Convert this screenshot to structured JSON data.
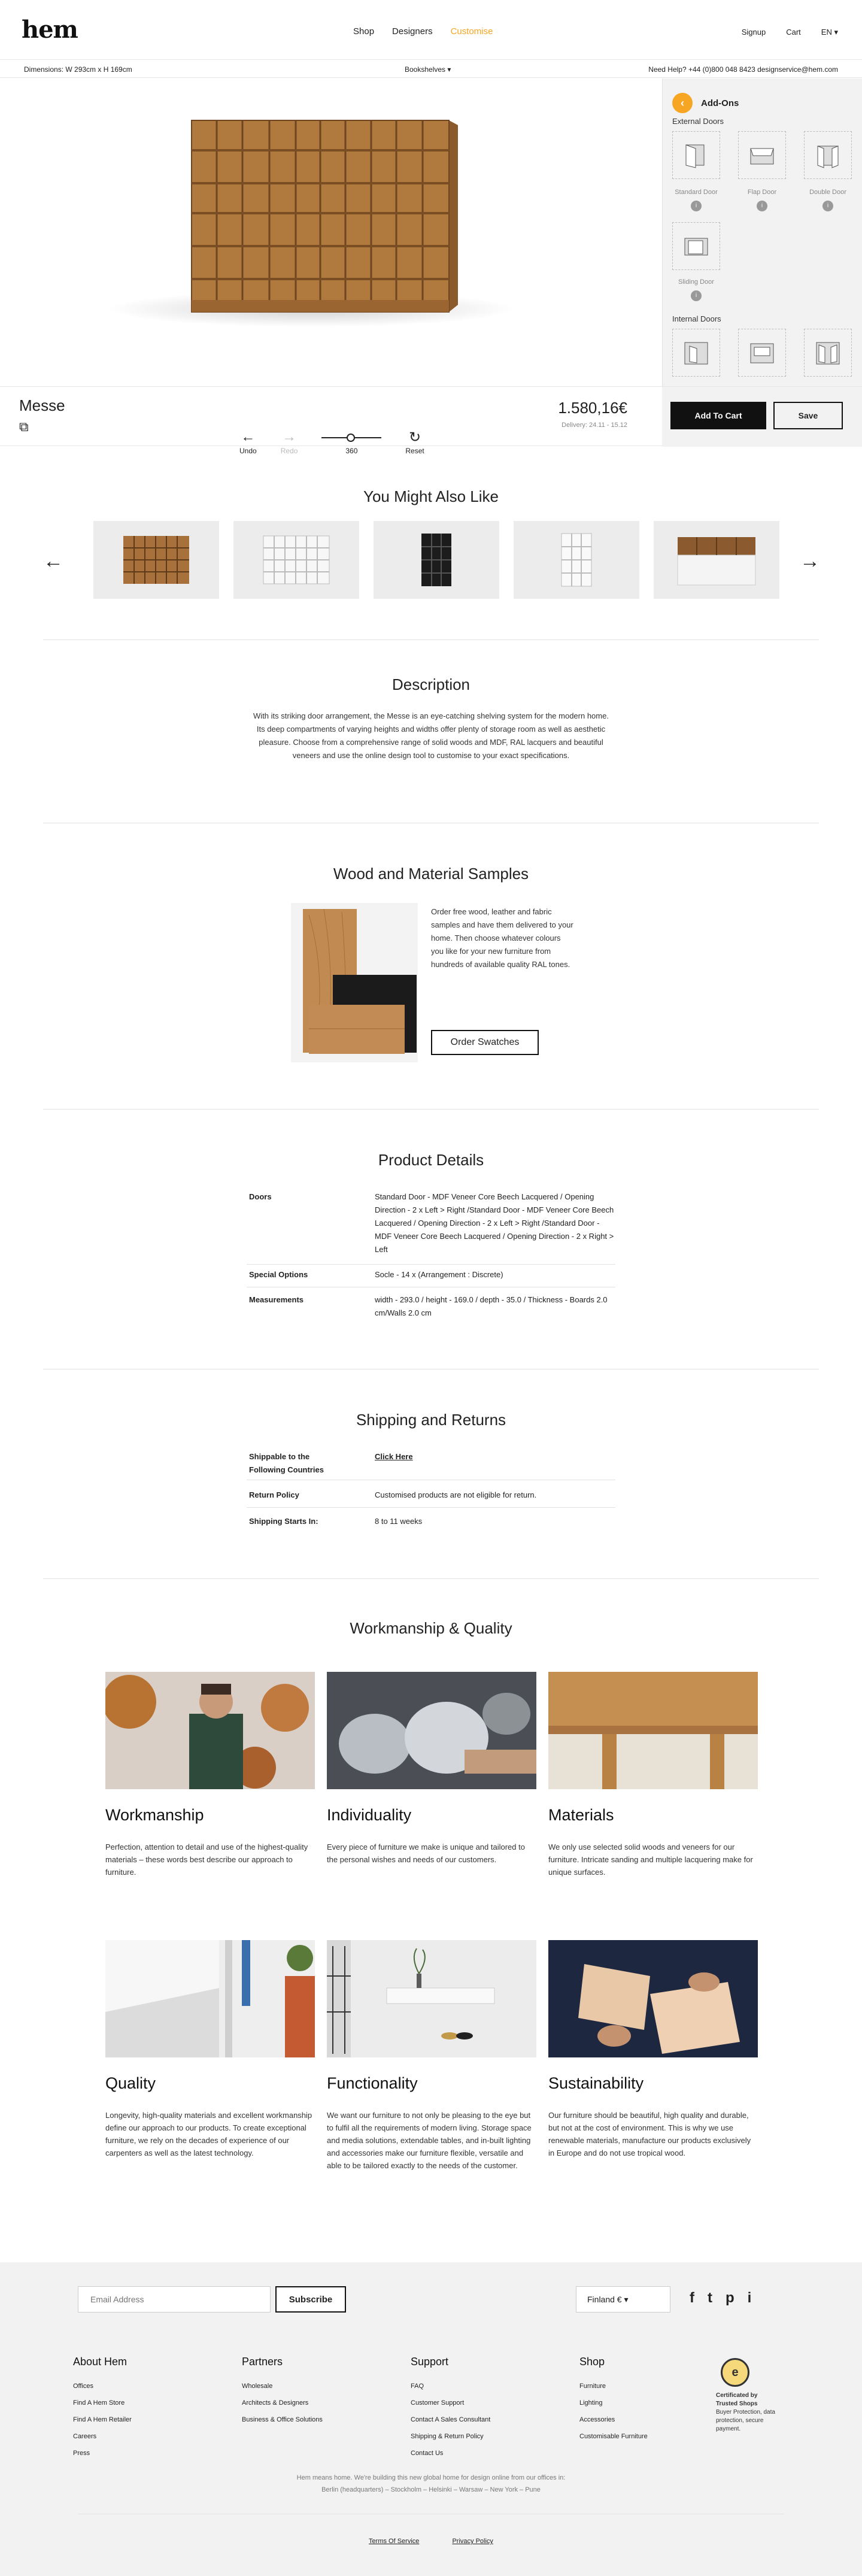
{
  "header": {
    "logo": "hem",
    "nav": [
      "Shop",
      "Designers",
      "Customise"
    ],
    "signup": "Signup",
    "cart": "Cart",
    "lang": "EN ▾"
  },
  "subbar": {
    "dimensions": "Dimensions:  W 293cm x H 169cm",
    "category": "Bookshelves  ▾",
    "help": "Need Help?   +44 (0)800 048 8423   designservice@hem.com"
  },
  "addons": {
    "title": "Add-Ons",
    "external_label": "External Doors",
    "internal_label": "Internal Doors",
    "external_doors": [
      "Standard Door",
      "Flap Door",
      "Double Door",
      "Sliding Door"
    ]
  },
  "controls": {
    "undo": "Undo",
    "redo": "Redo",
    "rotate": "360",
    "reset": "Reset"
  },
  "product": {
    "name": "Messe",
    "price": "1.580,16€",
    "delivery": "Delivery: 24.11 - 15.12",
    "add_to_cart": "Add To Cart",
    "save": "Save"
  },
  "related": {
    "title": "You Might Also Like"
  },
  "description": {
    "title": "Description",
    "text": "With its striking door arrangement, the Messe is an eye-catching shelving system for the modern home. Its deep compartments of varying heights and widths offer plenty of storage room as well as aesthetic pleasure. Choose from a comprehensive range of solid woods and MDF, RAL lacquers and beautiful veneers and use the online design tool to customise to your exact specifications."
  },
  "samples": {
    "title": "Wood and Material Samples",
    "text": "Order free wood, leather and fabric samples and have them delivered to your home. Then choose whatever colours you like for your new furniture from hundreds of available quality RAL tones.",
    "button": "Order Swatches"
  },
  "details": {
    "title": "Product Details",
    "rows": [
      {
        "k": "Doors",
        "v": "Standard Door - MDF Veneer Core Beech Lacquered / Opening Direction - 2 x Left > Right /Standard Door - MDF Veneer Core Beech Lacquered / Opening Direction - 2 x Left > Right /Standard Door - MDF Veneer Core Beech Lacquered / Opening Direction - 2 x Right > Left"
      },
      {
        "k": "Special Options",
        "v": "Socle - 14 x (Arrangement : Discrete)"
      },
      {
        "k": "Measurements",
        "v": "width - 293.0 / height - 169.0 / depth - 35.0 / Thickness - Boards 2.0 cm/Walls 2.0 cm"
      }
    ]
  },
  "shipping": {
    "title": "Shipping and Returns",
    "rows": [
      {
        "k": "Shippable to the Following Countries",
        "v": "Click Here"
      },
      {
        "k": "Return Policy",
        "v": "Customised products are not eligible for return."
      },
      {
        "k": "Shipping Starts In:",
        "v": "8 to 11 weeks"
      }
    ]
  },
  "workmanship": {
    "title": "Workmanship & Quality",
    "items": [
      {
        "title": "Workmanship",
        "text": "Perfection, attention to detail and use of the highest-quality materials – these words best describe our approach to furniture."
      },
      {
        "title": "Individuality",
        "text": "Every piece of furniture we make is unique and tailored to the personal wishes and needs of our customers."
      },
      {
        "title": "Materials",
        "text": "We only use selected solid woods and veneers for our furniture. Intricate sanding and multiple lacquering make for unique surfaces."
      },
      {
        "title": "Quality",
        "text": "Longevity, high-quality materials and excellent workmanship define our approach to our products. To create exceptional furniture, we rely on the decades of experience of our carpenters as well as the latest technology."
      },
      {
        "title": "Functionality",
        "text": "We want our furniture to not only be pleasing to the eye but to fulfil all the requirements of modern living. Storage space and media solutions, extendable tables, and in-built lighting and accessories make our furniture flexible, versatile and able to be tailored exactly to the needs of the customer."
      },
      {
        "title": "Sustainability",
        "text": "Our furniture should be beautiful, high quality and durable, but not at the cost of environment. This is why we use renewable materials, manufacture our products exclusively in Europe and do not use tropical wood."
      }
    ]
  },
  "footer": {
    "email_placeholder": "Email Address",
    "subscribe": "Subscribe",
    "country": "Finland €   ▾",
    "social": [
      "f",
      "t",
      "p",
      "i"
    ],
    "columns": [
      {
        "title": "About Hem",
        "links": [
          "Offices",
          "Find A Hem Store",
          "Find A Hem Retailer",
          "Careers",
          "Press"
        ]
      },
      {
        "title": "Partners",
        "links": [
          "Wholesale",
          "Architects & Designers",
          "Business & Office Solutions"
        ]
      },
      {
        "title": "Support",
        "links": [
          "FAQ",
          "Customer Support",
          "Contact A Sales Consultant",
          "Shipping & Return Policy",
          "Contact Us"
        ]
      },
      {
        "title": "Shop",
        "links": [
          "Furniture",
          "Lighting",
          "Accessories",
          "Customisable Furniture"
        ]
      }
    ],
    "trust_title": "Certificated by Trusted Shops",
    "trust_text": "Buyer Protection, data protection, secure payment.",
    "tagline": "Hem means home. We're building this new global home for design online from our offices in:",
    "cities": "Berlin (headquarters) – Stockholm – Helsinki – Warsaw – New York – Pune",
    "terms": "Terms Of Service",
    "privacy": "Privacy Policy"
  }
}
